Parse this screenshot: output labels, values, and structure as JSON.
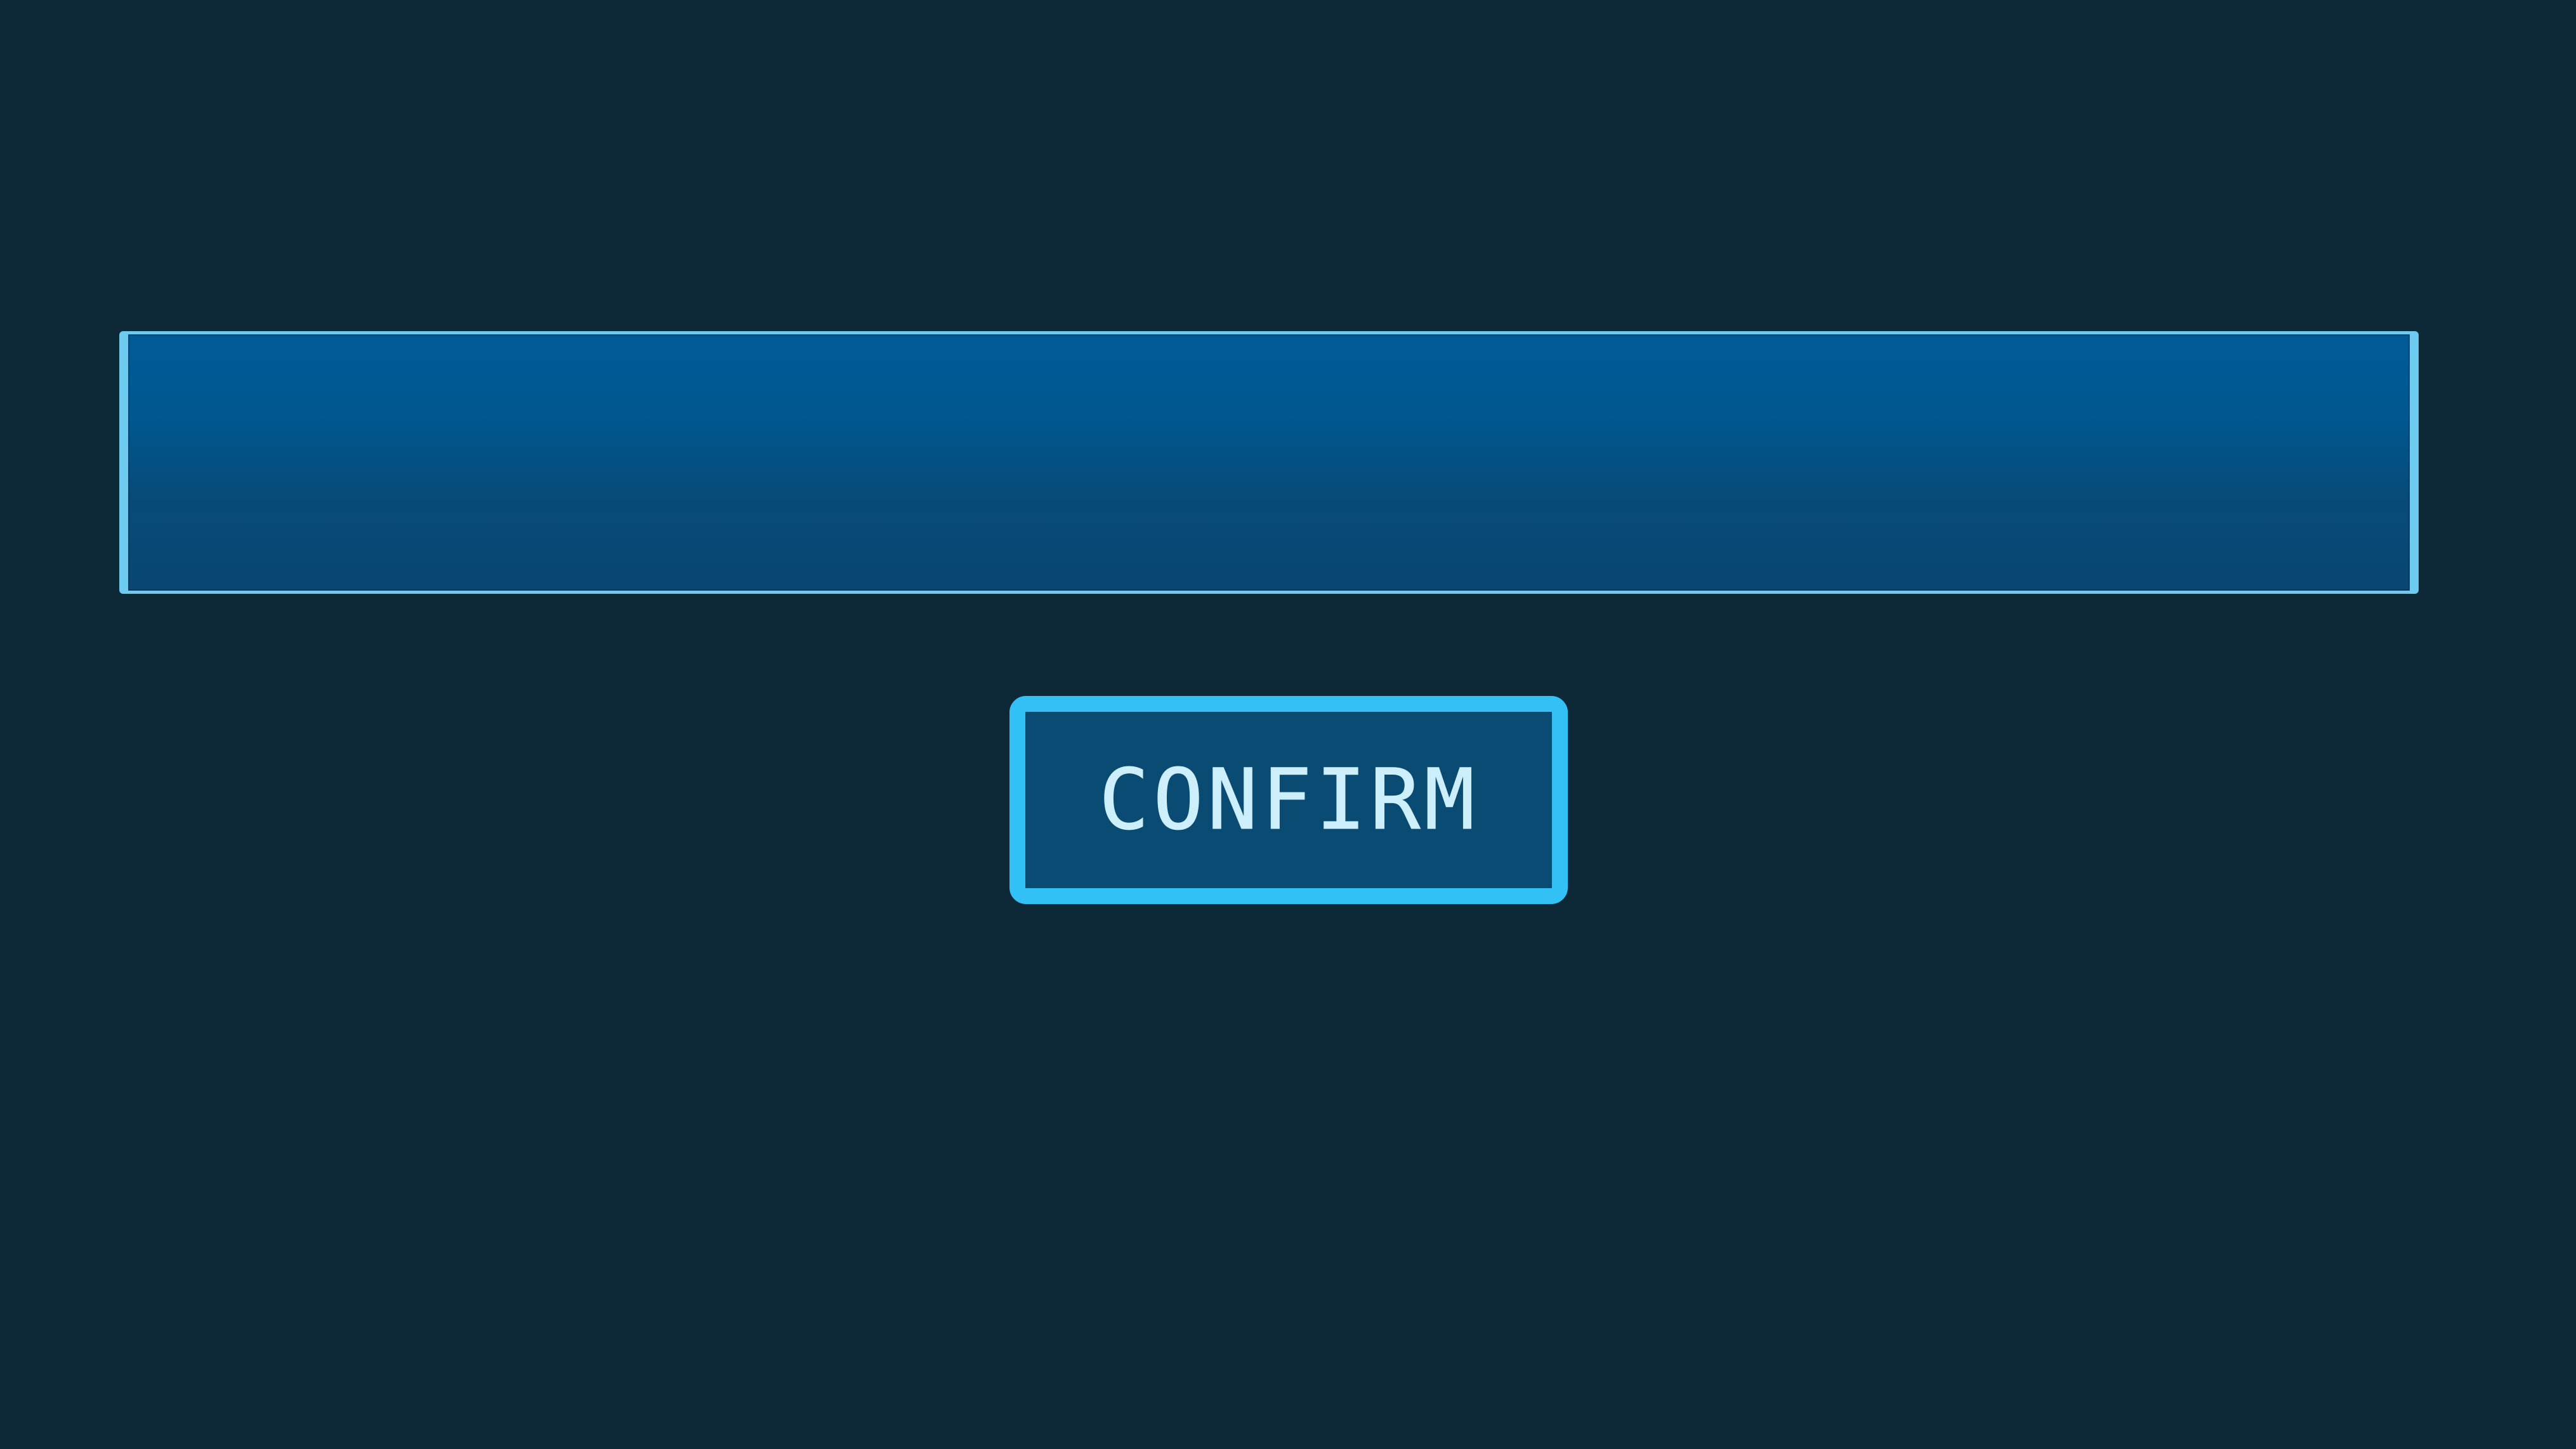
{
  "input": {
    "value": "",
    "placeholder": ""
  },
  "confirm_button": {
    "label": "CONFIRM"
  },
  "colors": {
    "background": "#0d2836",
    "input_fill_top": "#005a98",
    "input_fill_bottom": "#094672",
    "input_border": "#6fcaf0",
    "button_border": "#33c1f5",
    "button_fill": "#0a4b73",
    "button_text": "#cdeffc"
  }
}
